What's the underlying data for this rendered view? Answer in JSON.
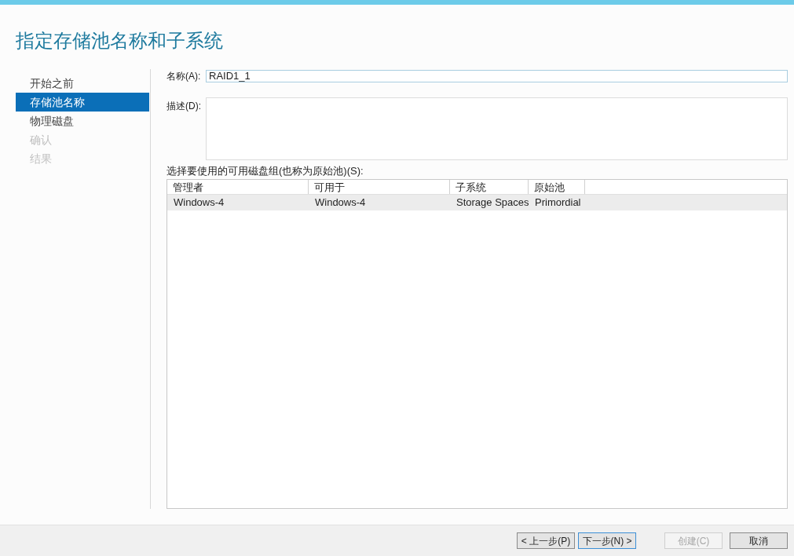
{
  "heading": "指定存储池名称和子系统",
  "steps": [
    {
      "label": "开始之前",
      "selected": false,
      "disabled": false
    },
    {
      "label": "存储池名称",
      "selected": true,
      "disabled": false
    },
    {
      "label": "物理磁盘",
      "selected": false,
      "disabled": false
    },
    {
      "label": "确认",
      "selected": false,
      "disabled": true
    },
    {
      "label": "结果",
      "selected": false,
      "disabled": true
    }
  ],
  "name_field": {
    "label": "名称(A):",
    "value": "RAID1_1"
  },
  "description_field": {
    "label": "描述(D):"
  },
  "table": {
    "label": "选择要使用的可用磁盘组(也称为原始池)(S):",
    "columns": [
      "管理者",
      "可用于",
      "子系统",
      "原始池"
    ],
    "rows": [
      {
        "cells": [
          "Windows-4",
          "Windows-4",
          "Storage Spaces",
          "Primordial"
        ],
        "selected": true
      }
    ]
  },
  "buttons": [
    {
      "label": "< 上一步(P)",
      "default": false,
      "disabled": false
    },
    {
      "label": "下一步(N) >",
      "default": true,
      "disabled": false
    },
    {
      "label": "创建(C)",
      "default": false,
      "disabled": true
    },
    {
      "label": "取消",
      "default": false,
      "disabled": false
    }
  ]
}
